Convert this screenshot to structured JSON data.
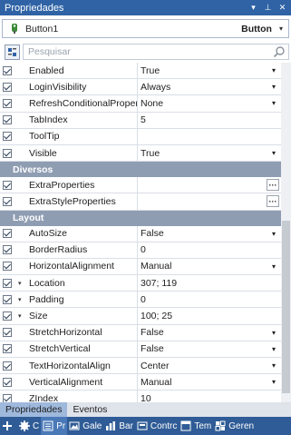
{
  "window": {
    "title": "Propriedades",
    "dropdown_glyph": "▾",
    "pin_glyph": "⊥",
    "close_glyph": "✕"
  },
  "selector": {
    "object_name": "Button1",
    "object_type": "Button",
    "dropdown_glyph": "▾"
  },
  "search": {
    "placeholder": "Pesquisar"
  },
  "grid": {
    "rows_top": [
      {
        "name": "Enabled",
        "value": "True",
        "control": "dropdown"
      },
      {
        "name": "LoginVisibility",
        "value": "Always",
        "control": "dropdown"
      },
      {
        "name": "RefreshConditionalPropertie",
        "value": "None",
        "control": "dropdown"
      },
      {
        "name": "TabIndex",
        "value": "5",
        "control": "text"
      },
      {
        "name": "ToolTip",
        "value": "",
        "control": "text"
      },
      {
        "name": "Visible",
        "value": "True",
        "control": "dropdown"
      }
    ],
    "category_diversos": "Diversos",
    "rows_diversos": [
      {
        "name": "ExtraProperties",
        "value": "",
        "control": "ellipsis"
      },
      {
        "name": "ExtraStyleProperties",
        "value": "",
        "control": "ellipsis"
      }
    ],
    "category_layout": "Layout",
    "rows_layout": [
      {
        "name": "AutoSize",
        "value": "False",
        "control": "dropdown",
        "expand": false
      },
      {
        "name": "BorderRadius",
        "value": "0",
        "control": "text",
        "expand": false
      },
      {
        "name": "HorizontalAlignment",
        "value": "Manual",
        "control": "dropdown",
        "expand": false
      },
      {
        "name": "Location",
        "value": "307; 119",
        "control": "text",
        "expand": true
      },
      {
        "name": "Padding",
        "value": "0",
        "control": "text",
        "expand": true
      },
      {
        "name": "Size",
        "value": "100; 25",
        "control": "text",
        "expand": true
      },
      {
        "name": "StretchHorizontal",
        "value": "False",
        "control": "dropdown",
        "expand": false
      },
      {
        "name": "StretchVertical",
        "value": "False",
        "control": "dropdown",
        "expand": false
      },
      {
        "name": "TextHorizontalAlign",
        "value": "Center",
        "control": "dropdown",
        "expand": false
      },
      {
        "name": "VerticalAlignment",
        "value": "Manual",
        "control": "dropdown",
        "expand": false
      },
      {
        "name": "ZIndex",
        "value": "10",
        "control": "text",
        "expand": false
      }
    ],
    "ellipsis_glyph": "···",
    "dropdown_glyph": "▾",
    "expand_glyph": "▾"
  },
  "tabs": [
    {
      "label": "Propriedades",
      "active": true
    },
    {
      "label": "Eventos",
      "active": false
    }
  ],
  "bottombar": {
    "items": [
      {
        "icon": "add-icon",
        "label": ""
      },
      {
        "icon": "gear-icon",
        "label": "C"
      },
      {
        "icon": "properties-icon",
        "label": "Pr"
      },
      {
        "icon": "gallery-icon",
        "label": "Gale"
      },
      {
        "icon": "bar-icon",
        "label": "Bar"
      },
      {
        "icon": "controls-icon",
        "label": "Contrc"
      },
      {
        "icon": "template-icon",
        "label": "Tem"
      },
      {
        "icon": "generate-icon",
        "label": "Geren"
      }
    ]
  },
  "colors": {
    "titlebar": "#2f63a5",
    "category": "#8f9db3",
    "bottombar": "#2f5c96",
    "active_tab": "#9fb9dc"
  }
}
